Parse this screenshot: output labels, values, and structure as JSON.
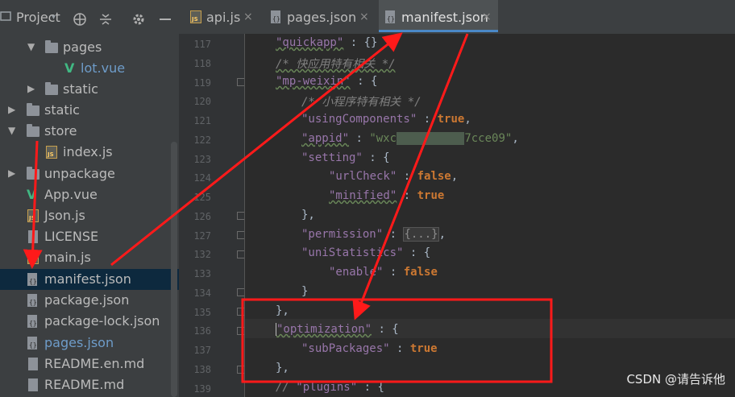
{
  "sidebar": {
    "title": "Project",
    "items": [
      {
        "label": "pages",
        "type": "folder",
        "expanded": true
      },
      {
        "label": "lot.vue",
        "type": "vue"
      },
      {
        "label": "static",
        "type": "folder",
        "expanded": false
      },
      {
        "label": "static",
        "type": "folder",
        "expanded": false
      },
      {
        "label": "store",
        "type": "folder",
        "expanded": true
      },
      {
        "label": "index.js",
        "type": "js"
      },
      {
        "label": "unpackage",
        "type": "folder",
        "expanded": false
      },
      {
        "label": "App.vue",
        "type": "vue"
      },
      {
        "label": "Json.js",
        "type": "js"
      },
      {
        "label": "LICENSE",
        "type": "doc"
      },
      {
        "label": "main.js",
        "type": "js"
      },
      {
        "label": "manifest.json",
        "type": "json",
        "selected": true
      },
      {
        "label": "package.json",
        "type": "json"
      },
      {
        "label": "package-lock.json",
        "type": "json"
      },
      {
        "label": "pages.json",
        "type": "json",
        "modified": true
      },
      {
        "label": "README.en.md",
        "type": "doc"
      },
      {
        "label": "README.md",
        "type": "doc"
      }
    ]
  },
  "tabs": [
    {
      "label": "api.js",
      "icon": "js-file-icon",
      "close": "×"
    },
    {
      "label": "pages.json",
      "icon": "json-file-icon",
      "close": "×"
    },
    {
      "label": "manifest.json",
      "icon": "json-file-icon",
      "close": "×",
      "active": true
    }
  ],
  "editor": {
    "line_numbers": [
      "117",
      "118",
      "119",
      "120",
      "121",
      "122",
      "123",
      "124",
      "125",
      "126",
      "127",
      "132",
      "133",
      "134",
      "135",
      "136",
      "137",
      "138",
      "139"
    ],
    "lines": {
      "l117_key": "\"quickapp\"",
      "l117_rest": " : {}",
      "l118_cmt": "/* 快应用特有相关 */",
      "l119_key": "\"mp-weixin\"",
      "l119_rest": " : {",
      "l120_cmt": "/* 小程序特有相关 */",
      "l121_key": "\"usingComponents\"",
      "l121_sep": " : ",
      "l121_val": "true",
      "l121_end": ",",
      "l122_key": "\"appid\"",
      "l122_sep": " : ",
      "l122_str1": "\"wxc",
      "l122_blur": "0000000000",
      "l122_str2": "7cce09\"",
      "l122_end": ",",
      "l123_key": "\"setting\"",
      "l123_rest": " : {",
      "l124_key": "\"urlCheck\"",
      "l124_sep": " : ",
      "l124_val": "false",
      "l124_end": ",",
      "l125_key": "\"minified\"",
      "l125_sep": " : ",
      "l125_val": "true",
      "l126": "},",
      "l127_key": "\"permission\"",
      "l127_sep": " : ",
      "l127_fold": "{...}",
      "l127_end": ",",
      "l132_key": "\"uniStatistics\"",
      "l132_rest": " : {",
      "l133_key": "\"enable\"",
      "l133_sep": " : ",
      "l133_val": "false",
      "l134": "}",
      "l135": "},",
      "l136_key": "\"optimization\"",
      "l136_rest": " : {",
      "l137_key": "\"subPackages\"",
      "l137_sep": " : ",
      "l137_val": "true",
      "l138": "},",
      "l139_cmt": "// ",
      "l139_key": "\"plugins\"",
      "l139_rest": " : {"
    }
  },
  "watermark": "CSDN @请告诉他",
  "colors": {
    "annotation": "#ff1a1a",
    "selection": "#0d293e",
    "tab_accent": "#4a88c7"
  }
}
